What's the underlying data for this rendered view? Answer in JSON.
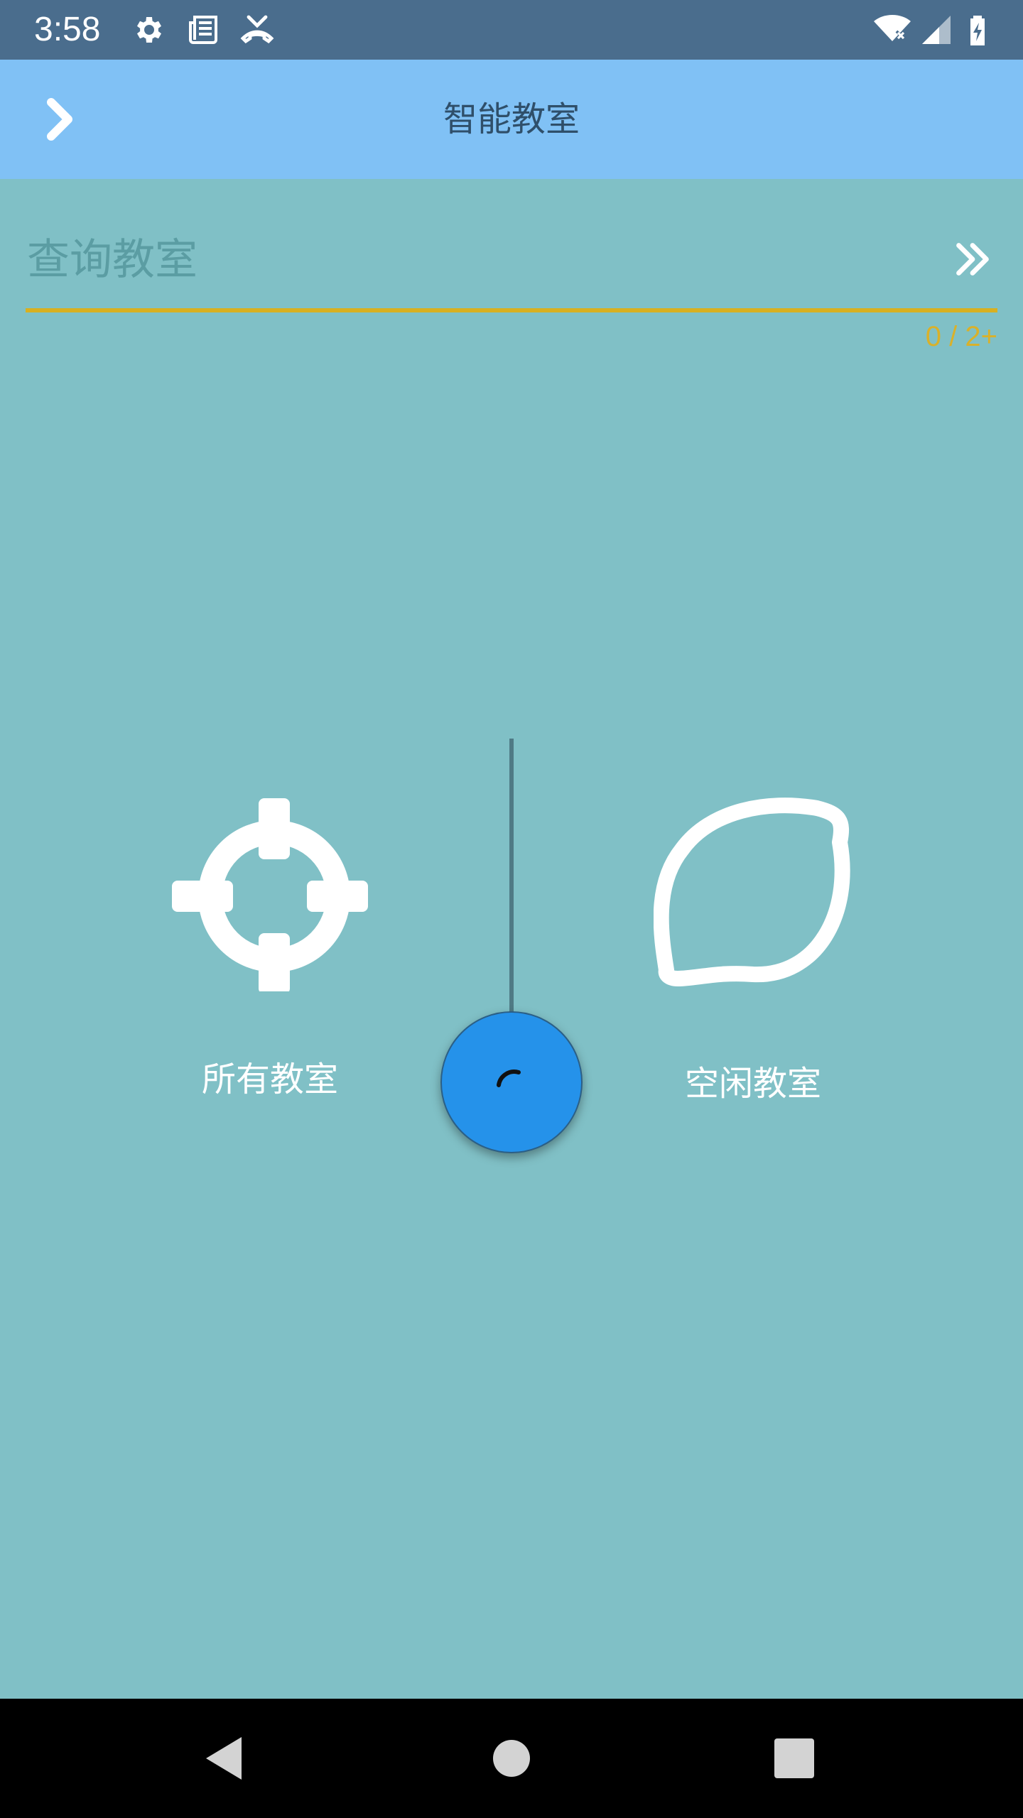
{
  "status_bar": {
    "time": "3:58",
    "left_icons": [
      "gear-icon",
      "newspaper-icon",
      "missed-call-icon"
    ],
    "right_icons": [
      "wifi-off-icon",
      "signal-icon",
      "battery-charging-icon"
    ]
  },
  "app_bar": {
    "title": "智能教室",
    "back_icon": "chevron-right-icon"
  },
  "search": {
    "placeholder": "查询教室",
    "value": "",
    "counter": "0 / 2+",
    "submit_icon": "double-chevron-right-icon"
  },
  "options": {
    "all_rooms_label": "所有教室",
    "all_rooms_icon": "crosshair-icon",
    "free_rooms_label": "空闲教室",
    "free_rooms_icon": "lemon-icon"
  },
  "center_button": {
    "icon": "loading-arc-icon"
  },
  "colors": {
    "background": "#80c0c6",
    "app_bar": "#80c1f5",
    "status_bar": "#4a6d8d",
    "accent": "#d8b020",
    "fab": "#2592ea"
  },
  "nav_bar": {
    "buttons": [
      "back-triangle-icon",
      "home-circle-icon",
      "recents-square-icon"
    ]
  }
}
